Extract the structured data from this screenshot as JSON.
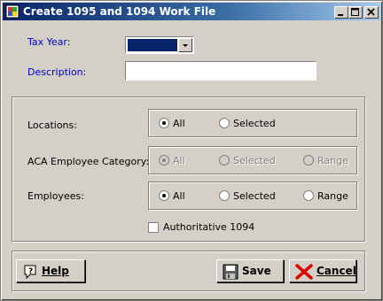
{
  "window": {
    "title": "Create 1095 and 1094 Work File",
    "icons": [
      "app-icon",
      "minimize-icon",
      "maximize-icon",
      "close-icon"
    ]
  },
  "form": {
    "tax_year_label": "Tax Year:",
    "tax_year_value": "",
    "description_label": "Description:",
    "description_value": ""
  },
  "filters": {
    "locations": {
      "label": "Locations:",
      "options": [
        "All",
        "Selected"
      ],
      "selected": "All",
      "enabled": true
    },
    "aca_category": {
      "label": "ACA Employee Category:",
      "options": [
        "All",
        "Selected",
        "Range"
      ],
      "selected": "All",
      "enabled": false
    },
    "employees": {
      "label": "Employees:",
      "options": [
        "All",
        "Selected",
        "Range"
      ],
      "selected": "All",
      "enabled": true
    },
    "authoritative": {
      "label": "Authoritative 1094",
      "checked": false
    }
  },
  "buttons": {
    "help": {
      "label": "Help",
      "icon": "help-icon"
    },
    "save": {
      "label": "Save",
      "icon": "floppy-disk-icon"
    },
    "cancel": {
      "label": "Cancel",
      "icon": "red-x-icon"
    }
  },
  "colors": {
    "title_bar": "#0a246a",
    "label_blue": "#0000d0",
    "face": "#d4d0c8"
  }
}
